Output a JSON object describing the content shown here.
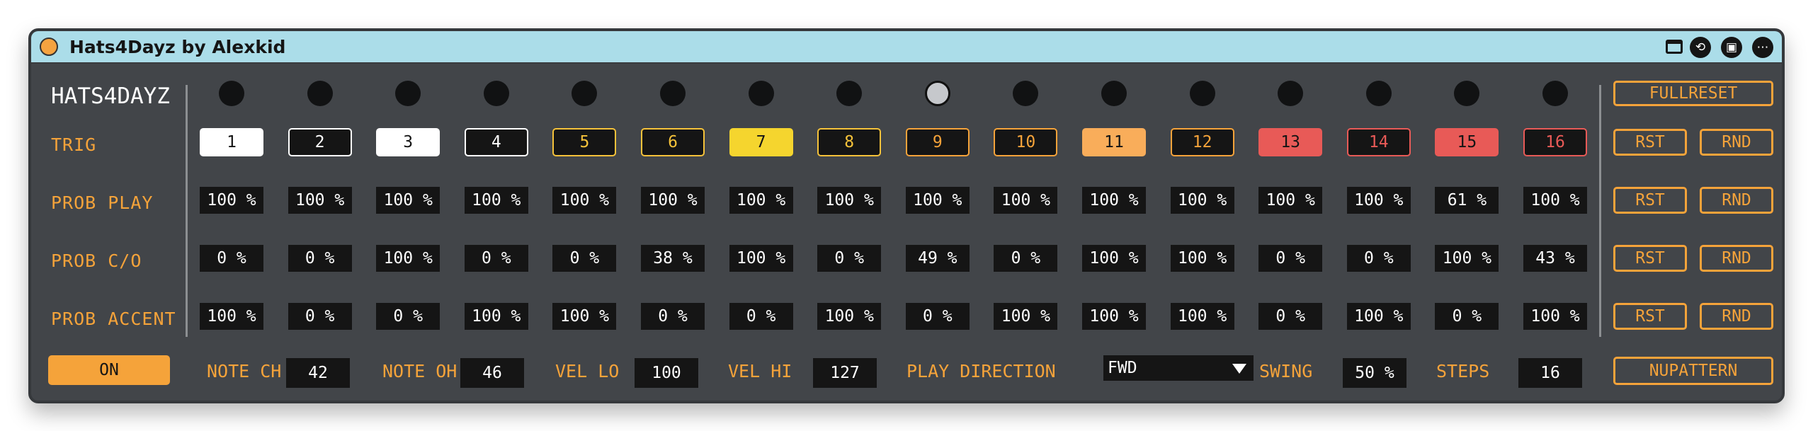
{
  "window": {
    "title": "Hats4Dayz by Alexkid"
  },
  "brand": "HATS4DAYZ",
  "row_labels": {
    "trig": "TRIG",
    "prob_play": "PROB PLAY",
    "prob_co": "PROB C/O",
    "prob_accent": "PROB ACCENT"
  },
  "active_step": 9,
  "trig_labels": [
    "1",
    "2",
    "3",
    "4",
    "5",
    "6",
    "7",
    "8",
    "9",
    "10",
    "11",
    "12",
    "13",
    "14",
    "15",
    "16"
  ],
  "prob_play": [
    "100 %",
    "100 %",
    "100 %",
    "100 %",
    "100 %",
    "100 %",
    "100 %",
    "100 %",
    "100 %",
    "100 %",
    "100 %",
    "100 %",
    "100 %",
    "100 %",
    "61 %",
    "100 %"
  ],
  "prob_co": [
    "0 %",
    "0 %",
    "100 %",
    "0 %",
    "0 %",
    "38 %",
    "100 %",
    "0 %",
    "49 %",
    "0 %",
    "100 %",
    "100 %",
    "0 %",
    "0 %",
    "100 %",
    "43 %"
  ],
  "prob_accent": [
    "100 %",
    "0 %",
    "0 %",
    "100 %",
    "100 %",
    "0 %",
    "0 %",
    "100 %",
    "0 %",
    "100 %",
    "100 %",
    "100 %",
    "0 %",
    "100 %",
    "0 %",
    "100 %"
  ],
  "buttons": {
    "fullreset": "FULLRESET",
    "rst": "RST",
    "rnd": "RND",
    "nupattern": "NUPATTERN",
    "on": "ON"
  },
  "bottom": {
    "note_ch_label": "NOTE CH",
    "note_ch": "42",
    "note_oh_label": "NOTE OH",
    "note_oh": "46",
    "vel_lo_label": "VEL LO",
    "vel_lo": "100",
    "vel_hi_label": "VEL HI",
    "vel_hi": "127",
    "play_dir_label": "PLAY DIRECTION",
    "play_dir": "FWD",
    "swing_label": "SWING",
    "swing": "50 %",
    "steps_label": "STEPS",
    "steps": "16"
  },
  "colors": {
    "accent": "#f5a33a",
    "panel": "#424549",
    "title_bar": "#abdde9",
    "field": "#151515"
  },
  "icons": {
    "title_dot": "orange-dot-icon",
    "calendar": "calendar-icon",
    "sync": "sync-icon",
    "save": "save-icon",
    "more": "more-icon"
  }
}
